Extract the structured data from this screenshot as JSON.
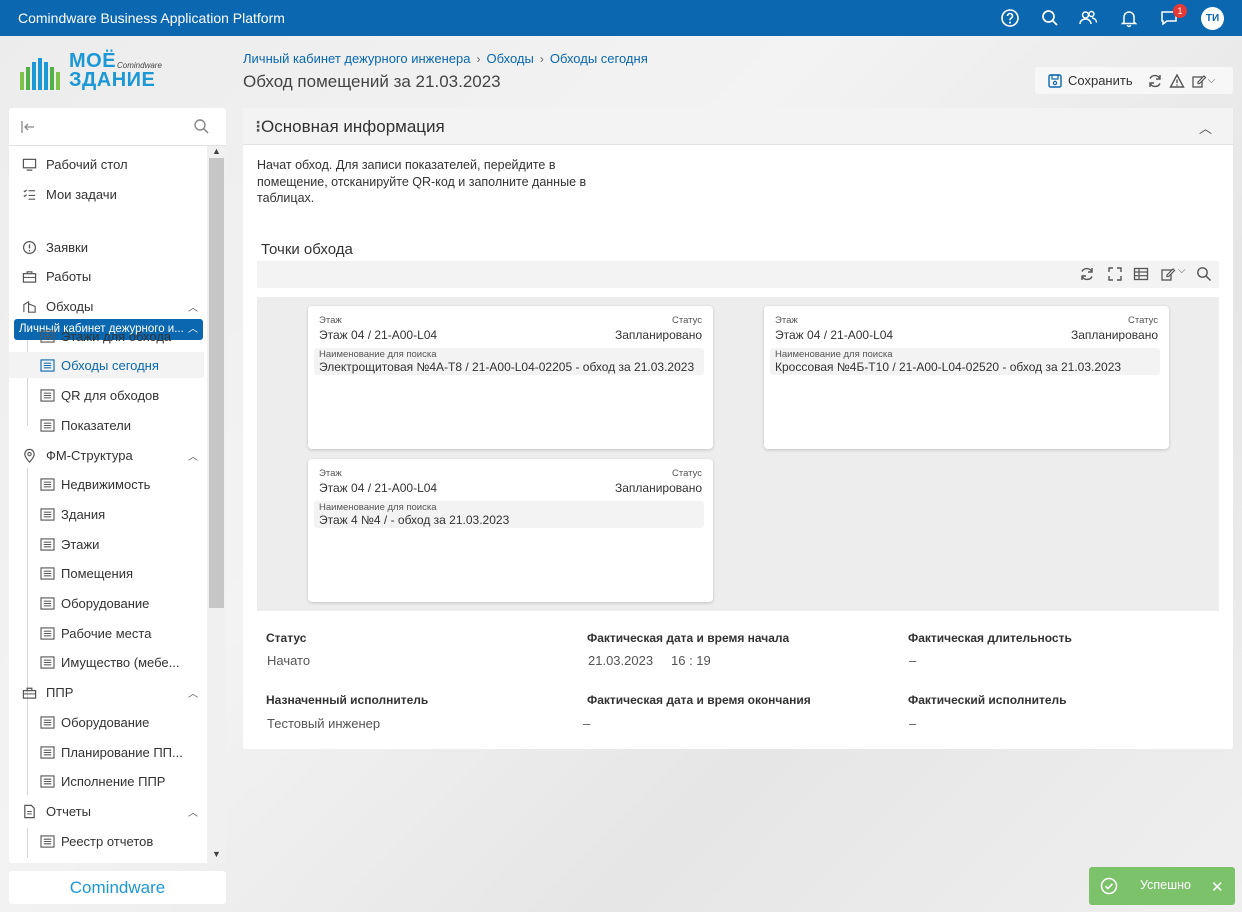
{
  "app": {
    "title": "Comindware Business Application Platform",
    "user_initials": "ТИ",
    "notification_count": "1"
  },
  "logo": {
    "line1": "МОЁ",
    "line2": "ЗДАНИЕ",
    "brand_small": "Comindware"
  },
  "breadcrumb": [
    "Личный кабинет дежурного инженера",
    "Обходы",
    "Обходы сегодня"
  ],
  "page_title": "Обход помещений за 21.03.2023",
  "toolbar": {
    "save_label": "Сохранить"
  },
  "sidebar": {
    "items": [
      {
        "label": "Рабочий стол",
        "icon": "desktop-icon"
      },
      {
        "label": "Мои задачи",
        "icon": "tasks-icon"
      },
      {
        "label": "Личный кабинет дежурного и...",
        "icon": "",
        "group": true
      },
      {
        "label": "Заявки",
        "icon": "info-circle-icon"
      },
      {
        "label": "Работы",
        "icon": "briefcase-icon"
      },
      {
        "label": "Обходы",
        "icon": "building-icon"
      },
      {
        "label": "Этажи для обхода",
        "icon": "list-icon"
      },
      {
        "label": "Обходы сегодня",
        "icon": "list-icon",
        "active": true
      },
      {
        "label": "QR для обходов",
        "icon": "list-icon"
      },
      {
        "label": "Показатели",
        "icon": "list-icon"
      },
      {
        "label": "ФМ-Структура",
        "icon": "location-pin-icon"
      },
      {
        "label": "Недвижимость",
        "icon": "list-icon"
      },
      {
        "label": "Здания",
        "icon": "list-icon"
      },
      {
        "label": "Этажи",
        "icon": "list-icon"
      },
      {
        "label": "Помещения",
        "icon": "list-icon"
      },
      {
        "label": "Оборудование",
        "icon": "list-icon"
      },
      {
        "label": "Рабочие места",
        "icon": "list-icon"
      },
      {
        "label": "Имущество (мебе...",
        "icon": "list-icon"
      },
      {
        "label": "ППР",
        "icon": "toolbox-icon"
      },
      {
        "label": "Оборудование",
        "icon": "list-icon"
      },
      {
        "label": "Планирование ПП...",
        "icon": "list-icon"
      },
      {
        "label": "Исполнение ППР",
        "icon": "list-icon"
      },
      {
        "label": "Отчеты",
        "icon": "document-icon"
      },
      {
        "label": "Реестр отчетов",
        "icon": "list-icon"
      }
    ],
    "footer_brand": "Comindware"
  },
  "panel": {
    "title": "Основная информация",
    "intro": "Начат обход. Для записи показателей, перейдите в помещение, отсканируйте QR-код и заполните данные в таблицах.",
    "section_title": "Точки обхода",
    "cards": [
      {
        "floor_label": "Этаж",
        "floor": "Этаж 04 / 21-A00-L04",
        "status_label": "Статус",
        "status": "Запланировано",
        "name_label": "Наименование для поиска",
        "name": "Электрощитовая №4А-Т8 / 21-A00-L04-02205 - обход за 21.03.2023"
      },
      {
        "floor_label": "Этаж",
        "floor": "Этаж 04 / 21-A00-L04",
        "status_label": "Статус",
        "status": "Запланировано",
        "name_label": "Наименование для поиска",
        "name": "Кроссовая №4Б-Т10 / 21-A00-L04-02520 - обход за 21.03.2023"
      },
      {
        "floor_label": "Этаж",
        "floor": "Этаж 04 / 21-A00-L04",
        "status_label": "Статус",
        "status": "Запланировано",
        "name_label": "Наименование для поиска",
        "name": "Этаж 4 №4 / - обход за 21.03.2023"
      }
    ],
    "fields": {
      "status_label": "Статус",
      "status": "Начато",
      "start_label": "Фактическая дата и время начала",
      "start_date": "21.03.2023",
      "start_time": "16 : 19",
      "duration_label": "Фактическая длительность",
      "duration": "–",
      "assignee_label": "Назначенный исполнитель",
      "assignee": "Тестовый инженер",
      "end_label": "Фактическая дата и время окончания",
      "end": "–",
      "actual_label": "Фактический исполнитель",
      "actual": "–"
    }
  },
  "toast": {
    "text": "Успешно"
  },
  "colors": {
    "header": "#0a67b0",
    "accent": "#1b98d5",
    "toast": "#7cc26b"
  }
}
